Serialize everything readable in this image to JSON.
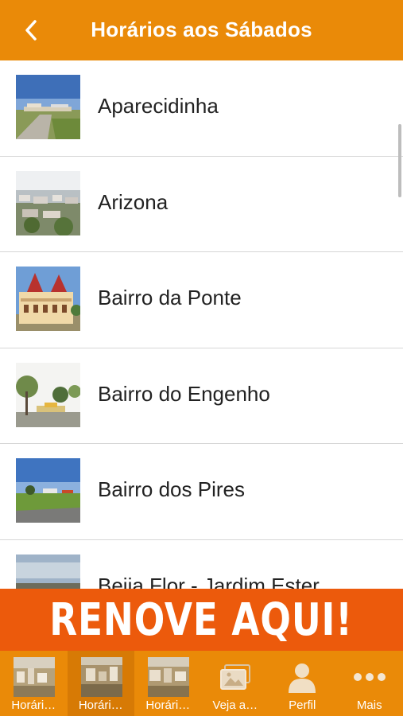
{
  "header": {
    "title": "Horários aos Sábados",
    "back_icon": "chevron-left-icon",
    "background": "#ea8a08"
  },
  "list": {
    "items": [
      {
        "label": "Aparecidinha"
      },
      {
        "label": "Arizona"
      },
      {
        "label": "Bairro da Ponte"
      },
      {
        "label": "Bairro do Engenho"
      },
      {
        "label": "Bairro dos Pires"
      },
      {
        "label": "Beija Flor - Jardim Ester"
      }
    ]
  },
  "banner": {
    "text": "RENOVE AQUI!",
    "background": "#ec5a0c"
  },
  "tabbar": {
    "background": "#ea8a08",
    "tabs": [
      {
        "label": "Horári…",
        "icon": "city-thumbnail",
        "active": false
      },
      {
        "label": "Horári…",
        "icon": "city-thumbnail",
        "active": true
      },
      {
        "label": "Horári…",
        "icon": "city-thumbnail",
        "active": false
      },
      {
        "label": "Veja a…",
        "icon": "photo-gallery-icon",
        "active": false
      },
      {
        "label": "Perfil",
        "icon": "user-icon",
        "active": false
      },
      {
        "label": "Mais",
        "icon": "more-dots-icon",
        "active": false
      }
    ]
  }
}
